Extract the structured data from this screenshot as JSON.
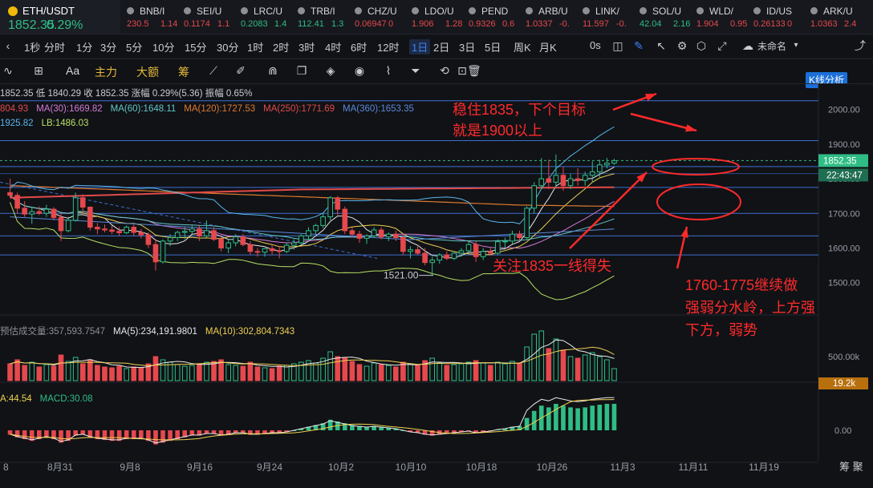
{
  "ticker": {
    "main": {
      "symbol": "ETH/USDT",
      "price": "1852.35",
      "change": "0.29%"
    },
    "items": [
      {
        "symbol": "BNB/I",
        "price": "230.5",
        "change": "1.14",
        "up": false
      },
      {
        "symbol": "SEI/U",
        "price": "0.1174",
        "change": "1.1",
        "up": false
      },
      {
        "symbol": "LRC/U",
        "price": "0.2083",
        "change": "1.4",
        "up": true
      },
      {
        "symbol": "TRB/I",
        "price": "112.41",
        "change": "1.3",
        "up": true
      },
      {
        "symbol": "CHZ/U",
        "price": "0.06947",
        "change": "0",
        "up": false
      },
      {
        "symbol": "LDO/U",
        "price": "1.906",
        "change": "1.28",
        "up": false
      },
      {
        "symbol": "PEND",
        "price": "0.9326",
        "change": "0.6",
        "up": false
      },
      {
        "symbol": "ARB/U",
        "price": "1.0337",
        "change": "-0.",
        "up": false
      },
      {
        "symbol": "LINK/",
        "price": "11.597",
        "change": "-0.",
        "up": false
      },
      {
        "symbol": "SOL/U",
        "price": "42.04",
        "change": "2.16",
        "up": true
      },
      {
        "symbol": "WLD/",
        "price": "1.904",
        "change": "0.95",
        "up": false
      },
      {
        "symbol": "ID/US",
        "price": "0.26133",
        "change": "0",
        "up": false
      },
      {
        "symbol": "ARK/U",
        "price": "1.0363",
        "change": "2.4",
        "up": false
      }
    ]
  },
  "toolbar": {
    "periods": [
      "1秒",
      "分时",
      "1分",
      "3分",
      "5分",
      "10分",
      "15分",
      "30分",
      "1时",
      "2时",
      "3时",
      "4时",
      "6时",
      "12时",
      "1日",
      "2日",
      "3日",
      "5日",
      "周K",
      "月K"
    ],
    "active_period": "1日",
    "zero_s": "0s",
    "chart_name": "未命名",
    "kline_button": "K线分析",
    "tools": {
      "text": "Aa",
      "main": "主力",
      "big": "大额",
      "chip": "筹"
    }
  },
  "legends": {
    "ohlc": "1852.35  低 1840.29  收 1852.35  涨幅 0.29%(5.36)  振幅 0.65%",
    "ma_line": [
      {
        "text": "804.93",
        "color": "#e24a4a"
      },
      {
        "text": "MA(30):1669.82",
        "color": "#d47ad4"
      },
      {
        "text": "MA(60):1648.11",
        "color": "#62c6c6"
      },
      {
        "text": "MA(120):1727.53",
        "color": "#e07a2e"
      },
      {
        "text": "MA(250):1771.69",
        "color": "#e24a4a"
      },
      {
        "text": "MA(360):1653.35",
        "color": "#5a88d8"
      }
    ],
    "boll": [
      {
        "text": "1925.82",
        "color": "#5ab4e8"
      },
      {
        "text": "LB:1486.03",
        "color": "#b8e063"
      }
    ],
    "volume": [
      {
        "text": "预估成交量:357,593.7547",
        "color": "#8c8f96"
      },
      {
        "text": "MA(5):234,191.9801",
        "color": "#e8e8e8"
      },
      {
        "text": "MA(10):302,804.7343",
        "color": "#f0d050"
      }
    ],
    "macd": [
      {
        "text": "A:44.54",
        "color": "#f0d050"
      },
      {
        "text": "MACD:30.08",
        "color": "#2fbd85"
      }
    ]
  },
  "price_axis": {
    "ticks": [
      "2000.00",
      "1900.00",
      "1800.00",
      "1700.00",
      "1600.00",
      "1500.00"
    ],
    "current_price": "1852.35",
    "countdown": "22:43:47",
    "volume_tick": "500.00k",
    "volume_current": "19.2k",
    "macd_tick": "0.00"
  },
  "time_axis": {
    "ticks": [
      "8",
      "8月31",
      "9月8",
      "9月16",
      "9月24",
      "10月2",
      "10月10",
      "10月18",
      "10月26",
      "11月3",
      "11月11",
      "11月19"
    ],
    "right_label": "筹 聚"
  },
  "annotations": {
    "low_label": "1521.00",
    "note1_line1": "稳住1835，下个目标",
    "note1_line2": "就是1900以上",
    "note2": "关注1835一线得失",
    "note3_line1": "1760-1775继续做",
    "note3_line2": "强弱分水岭，上方强",
    "note3_line3": "下方，弱势"
  },
  "colors": {
    "up": "#2fbd85",
    "down": "#e5484d",
    "annotation": "#ff2a2a"
  },
  "chart_data": {
    "type": "candlestick",
    "title": "ETH/USDT 1日",
    "y_range": [
      1460,
      2050
    ],
    "volume_range": [
      0,
      700000
    ],
    "candles": [
      [
        1760,
        1800,
        1745,
        1752
      ],
      [
        1752,
        1760,
        1700,
        1715
      ],
      [
        1715,
        1735,
        1690,
        1698
      ],
      [
        1698,
        1715,
        1670,
        1705
      ],
      [
        1705,
        1720,
        1695,
        1700
      ],
      [
        1700,
        1725,
        1690,
        1712
      ],
      [
        1712,
        1718,
        1680,
        1688
      ],
      [
        1688,
        1700,
        1620,
        1650
      ],
      [
        1650,
        1690,
        1645,
        1680
      ],
      [
        1680,
        1760,
        1676,
        1745
      ],
      [
        1745,
        1755,
        1705,
        1718
      ],
      [
        1718,
        1720,
        1650,
        1660
      ],
      [
        1660,
        1672,
        1640,
        1655
      ],
      [
        1655,
        1668,
        1645,
        1652
      ],
      [
        1652,
        1665,
        1640,
        1648
      ],
      [
        1648,
        1660,
        1635,
        1644
      ],
      [
        1644,
        1665,
        1640,
        1660
      ],
      [
        1660,
        1668,
        1635,
        1645
      ],
      [
        1645,
        1655,
        1628,
        1638
      ],
      [
        1638,
        1645,
        1600,
        1610
      ],
      [
        1610,
        1625,
        1535,
        1560
      ],
      [
        1560,
        1625,
        1555,
        1620
      ],
      [
        1620,
        1640,
        1605,
        1630
      ],
      [
        1630,
        1650,
        1620,
        1645
      ],
      [
        1645,
        1660,
        1625,
        1648
      ],
      [
        1648,
        1665,
        1640,
        1655
      ],
      [
        1655,
        1665,
        1620,
        1635
      ],
      [
        1635,
        1680,
        1630,
        1650
      ],
      [
        1650,
        1660,
        1620,
        1625
      ],
      [
        1625,
        1640,
        1590,
        1600
      ],
      [
        1600,
        1625,
        1585,
        1615
      ],
      [
        1615,
        1640,
        1605,
        1632
      ],
      [
        1632,
        1640,
        1605,
        1610
      ],
      [
        1610,
        1620,
        1580,
        1590
      ],
      [
        1590,
        1600,
        1575,
        1588
      ],
      [
        1588,
        1600,
        1575,
        1598
      ],
      [
        1598,
        1610,
        1580,
        1592
      ],
      [
        1592,
        1605,
        1570,
        1590
      ],
      [
        1590,
        1615,
        1585,
        1608
      ],
      [
        1608,
        1625,
        1595,
        1615
      ],
      [
        1615,
        1640,
        1608,
        1635
      ],
      [
        1635,
        1660,
        1620,
        1650
      ],
      [
        1650,
        1670,
        1640,
        1665
      ],
      [
        1665,
        1700,
        1658,
        1690
      ],
      [
        1690,
        1750,
        1680,
        1745
      ],
      [
        1745,
        1750,
        1695,
        1712
      ],
      [
        1712,
        1720,
        1640,
        1650
      ],
      [
        1650,
        1660,
        1630,
        1640
      ],
      [
        1640,
        1650,
        1615,
        1628
      ],
      [
        1628,
        1640,
        1612,
        1635
      ],
      [
        1635,
        1660,
        1630,
        1652
      ],
      [
        1652,
        1660,
        1625,
        1632
      ],
      [
        1632,
        1645,
        1620,
        1640
      ],
      [
        1640,
        1650,
        1620,
        1630
      ],
      [
        1630,
        1640,
        1580,
        1590
      ],
      [
        1590,
        1605,
        1570,
        1595
      ],
      [
        1595,
        1605,
        1580,
        1585
      ],
      [
        1585,
        1600,
        1550,
        1558
      ],
      [
        1558,
        1575,
        1521,
        1565
      ],
      [
        1565,
        1585,
        1555,
        1580
      ],
      [
        1580,
        1590,
        1565,
        1570
      ],
      [
        1570,
        1590,
        1565,
        1585
      ],
      [
        1585,
        1600,
        1575,
        1592
      ],
      [
        1592,
        1620,
        1585,
        1610
      ],
      [
        1610,
        1620,
        1560,
        1575
      ],
      [
        1575,
        1600,
        1565,
        1590
      ],
      [
        1590,
        1600,
        1578,
        1585
      ],
      [
        1585,
        1625,
        1580,
        1618
      ],
      [
        1618,
        1630,
        1600,
        1620
      ],
      [
        1620,
        1650,
        1612,
        1640
      ],
      [
        1640,
        1650,
        1620,
        1630
      ],
      [
        1630,
        1720,
        1625,
        1715
      ],
      [
        1715,
        1790,
        1700,
        1780
      ],
      [
        1780,
        1860,
        1770,
        1800
      ],
      [
        1800,
        1855,
        1770,
        1790
      ],
      [
        1790,
        1870,
        1775,
        1810
      ],
      [
        1810,
        1835,
        1765,
        1780
      ],
      [
        1780,
        1815,
        1770,
        1800
      ],
      [
        1800,
        1830,
        1780,
        1795
      ],
      [
        1795,
        1820,
        1780,
        1810
      ],
      [
        1810,
        1850,
        1790,
        1820
      ],
      [
        1820,
        1855,
        1805,
        1840
      ],
      [
        1840,
        1860,
        1830,
        1845
      ],
      [
        1845,
        1858,
        1840,
        1852
      ]
    ],
    "volume": [
      210000,
      260000,
      190000,
      230000,
      170000,
      200000,
      180000,
      320000,
      240000,
      290000,
      210000,
      260000,
      190000,
      170000,
      160000,
      180000,
      150000,
      170000,
      160000,
      210000,
      300000,
      260000,
      230000,
      200000,
      180000,
      190000,
      210000,
      230000,
      240000,
      260000,
      200000,
      190000,
      180000,
      230000,
      170000,
      160000,
      150000,
      180000,
      190000,
      210000,
      230000,
      250000,
      220000,
      280000,
      360000,
      300000,
      290000,
      240000,
      200000,
      180000,
      220000,
      200000,
      190000,
      170000,
      230000,
      210000,
      190000,
      250000,
      280000,
      220000,
      190000,
      200000,
      210000,
      230000,
      250000,
      220000,
      190000,
      230000,
      210000,
      240000,
      220000,
      420000,
      580000,
      620000,
      400000,
      520000,
      380000,
      300000,
      280000,
      320000,
      350000,
      300000,
      260000,
      150000
    ],
    "macd_hist": [
      -5,
      -8,
      -10,
      -12,
      -10,
      -8,
      -10,
      -14,
      -12,
      -6,
      -5,
      -8,
      -10,
      -11,
      -12,
      -12,
      -10,
      -10,
      -10,
      -12,
      -16,
      -14,
      -12,
      -10,
      -8,
      -6,
      -6,
      -4,
      -4,
      -6,
      -5,
      -3,
      -3,
      -5,
      -5,
      -4,
      -3,
      -3,
      -2,
      0,
      2,
      4,
      6,
      8,
      12,
      10,
      8,
      6,
      5,
      4,
      5,
      4,
      3,
      2,
      0,
      -2,
      -3,
      -5,
      -6,
      -5,
      -4,
      -3,
      -2,
      -1,
      -3,
      -2,
      -1,
      1,
      2,
      4,
      5,
      14,
      22,
      28,
      26,
      30,
      28,
      26,
      25,
      26,
      28,
      29,
      30,
      30
    ],
    "horizontal_levels": [
      2025,
      1910,
      1835,
      1775,
      1700,
      1635,
      1580,
      1521
    ],
    "current_price": 1852.35,
    "low_price": 1521.0
  }
}
